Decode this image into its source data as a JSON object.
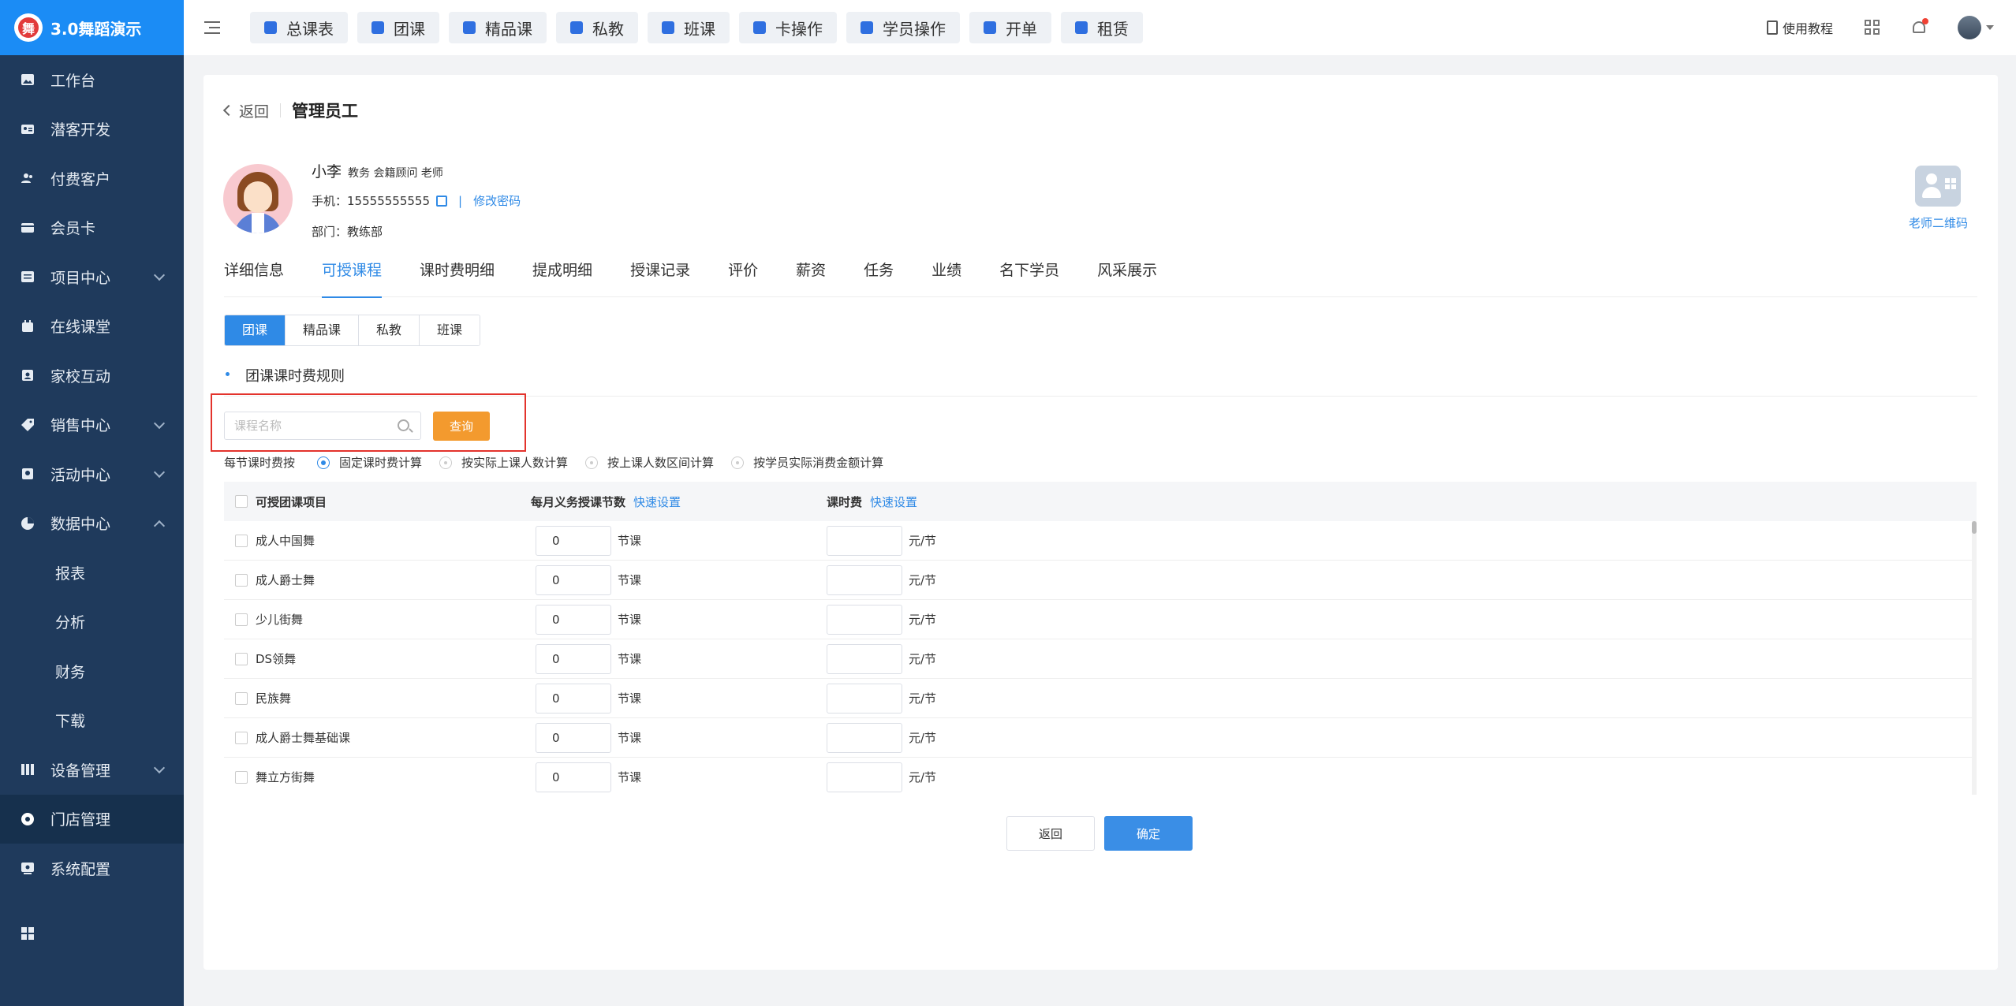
{
  "brand": {
    "title": "3.0舞蹈演示",
    "logo_char": "舞"
  },
  "sidebar": {
    "items": [
      {
        "label": "工作台",
        "icon": "image-icon"
      },
      {
        "label": "潜客开发",
        "icon": "id-card-icon"
      },
      {
        "label": "付费客户",
        "icon": "users-icon"
      },
      {
        "label": "会员卡",
        "icon": "card-icon"
      },
      {
        "label": "项目中心",
        "icon": "project-icon"
      },
      {
        "label": "在线课堂",
        "icon": "classroom-icon"
      },
      {
        "label": "家校互动",
        "icon": "contact-icon"
      },
      {
        "label": "销售中心",
        "icon": "tag-icon"
      },
      {
        "label": "活动中心",
        "icon": "activity-icon"
      },
      {
        "label": "数据中心",
        "icon": "chart-pie-icon"
      },
      {
        "label": "设备管理",
        "icon": "device-icon"
      },
      {
        "label": "门店管理",
        "icon": "store-icon"
      },
      {
        "label": "系统配置",
        "icon": "settings-icon"
      }
    ],
    "data_sub": [
      "报表",
      "分析",
      "财务",
      "下载"
    ]
  },
  "topbar": {
    "quick": [
      "总课表",
      "团课",
      "精品课",
      "私教",
      "班课",
      "卡操作",
      "学员操作",
      "开单",
      "租赁"
    ],
    "tutorial": "使用教程"
  },
  "header": {
    "back": "返回",
    "title": "管理员工"
  },
  "profile": {
    "name": "小李",
    "roles": "教务 会籍顾问 老师",
    "phone_label": "手机：",
    "phone": "15555555555",
    "separator": "|",
    "change_password": "修改密码",
    "dept_label": "部门：",
    "dept": "教练部",
    "qr_label": "老师二维码"
  },
  "tabs": [
    "详细信息",
    "可授课程",
    "课时费明细",
    "提成明细",
    "授课记录",
    "评价",
    "薪资",
    "任务",
    "业绩",
    "名下学员",
    "风采展示"
  ],
  "course_types": [
    "团课",
    "精品课",
    "私教",
    "班课"
  ],
  "section_title": "团课课时费规则",
  "search": {
    "placeholder": "课程名称",
    "button": "查询"
  },
  "calc": {
    "label": "每节课时费按",
    "options": [
      "固定课时费计算",
      "按实际上课人数计算",
      "按上课人数区间计算",
      "按学员实际消费金额计算"
    ]
  },
  "table": {
    "headers": {
      "project": "可授团课项目",
      "monthly": "每月义务授课节数",
      "fee": "课时费",
      "quick_set": "快速设置"
    },
    "unit_lessons": "节课",
    "unit_fee": "元/节",
    "rows": [
      {
        "name": "成人中国舞",
        "value": "0"
      },
      {
        "name": "成人爵士舞",
        "value": "0"
      },
      {
        "name": "少儿街舞",
        "value": "0"
      },
      {
        "name": "DS领舞",
        "value": "0"
      },
      {
        "name": "民族舞",
        "value": "0"
      },
      {
        "name": "成人爵士舞基础课",
        "value": "0"
      },
      {
        "name": "舞立方街舞",
        "value": "0"
      }
    ]
  },
  "footer": {
    "back": "返回",
    "confirm": "确定"
  },
  "colors": {
    "primary": "#2f8ae6",
    "sidebar": "#1f3a5c",
    "query": "#f39a2e",
    "highlight": "#e3332c"
  }
}
